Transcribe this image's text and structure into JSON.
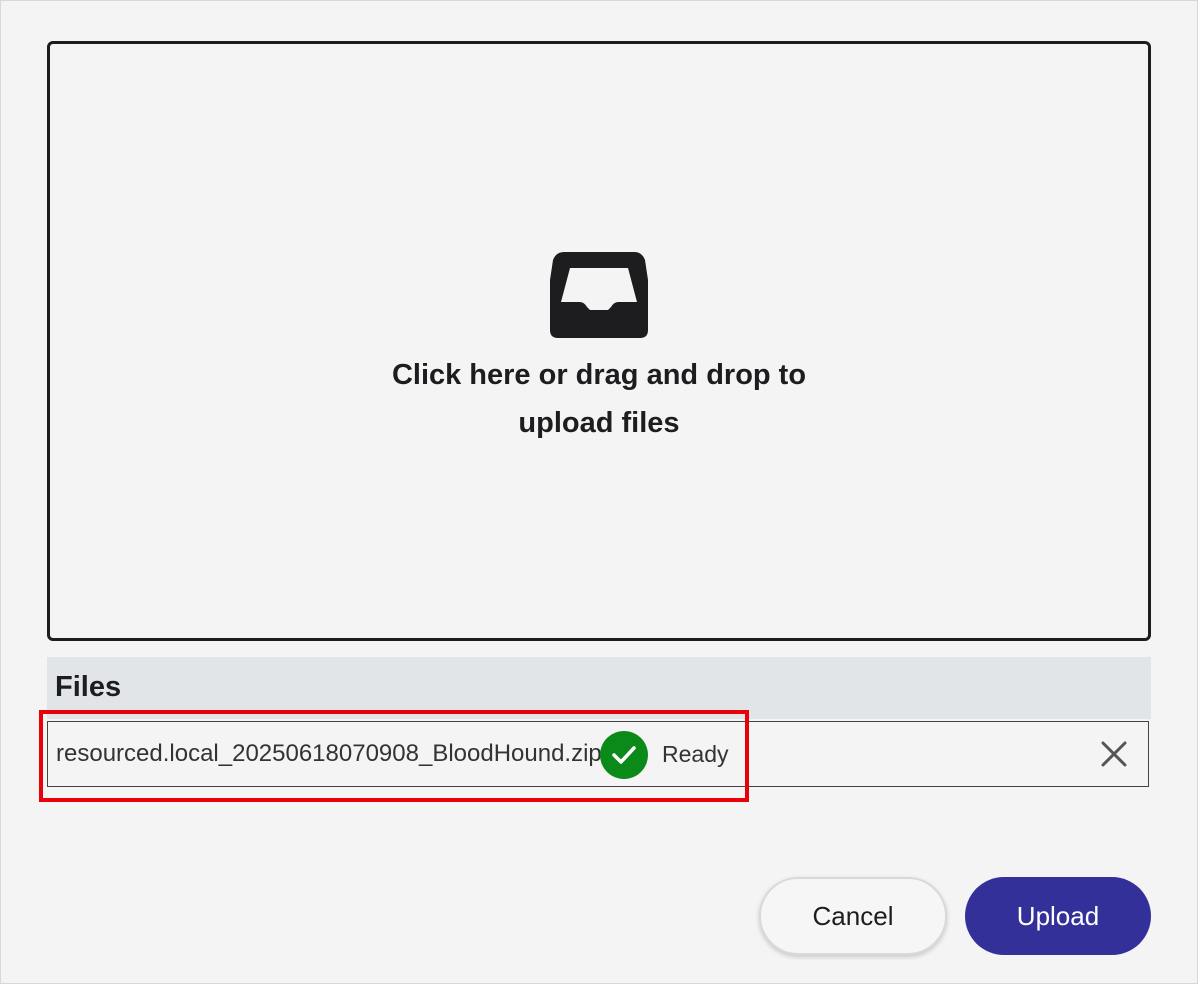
{
  "dropzone": {
    "icon": "inbox-tray-icon",
    "instruction": "Click here or drag and drop to upload files"
  },
  "files": {
    "title": "Files",
    "items": [
      {
        "name": "resourced.local_20250618070908_BloodHound.zip",
        "status_icon": "check-circle-icon",
        "status": "Ready",
        "remove_icon": "close-icon"
      }
    ]
  },
  "actions": {
    "cancel_label": "Cancel",
    "upload_label": "Upload"
  },
  "colors": {
    "accent": "#33309a",
    "success": "#0b8a19",
    "highlight": "#e8000b",
    "text": "#1d1d20"
  }
}
